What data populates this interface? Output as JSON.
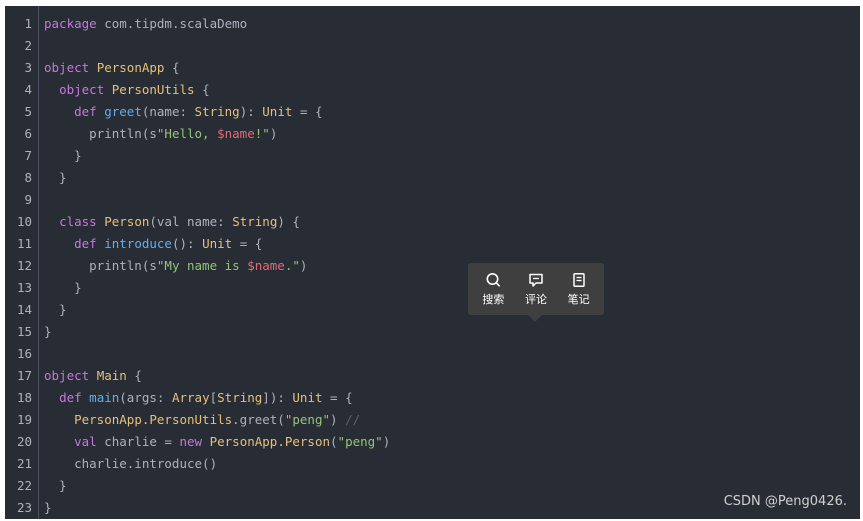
{
  "code_lines": [
    [
      {
        "t": "package",
        "c": "kw"
      },
      {
        "t": " com.tipdm.scalaDemo",
        "c": ""
      }
    ],
    [],
    [
      {
        "t": "object",
        "c": "kw"
      },
      {
        "t": " ",
        "c": ""
      },
      {
        "t": "PersonApp",
        "c": "cls"
      },
      {
        "t": " {",
        "c": ""
      }
    ],
    [
      {
        "t": "  ",
        "c": ""
      },
      {
        "t": "object",
        "c": "kw"
      },
      {
        "t": " ",
        "c": ""
      },
      {
        "t": "PersonUtils",
        "c": "cls"
      },
      {
        "t": " {",
        "c": ""
      }
    ],
    [
      {
        "t": "    ",
        "c": ""
      },
      {
        "t": "def",
        "c": "kw"
      },
      {
        "t": " ",
        "c": ""
      },
      {
        "t": "greet",
        "c": "fn"
      },
      {
        "t": "(name: ",
        "c": ""
      },
      {
        "t": "String",
        "c": "typ"
      },
      {
        "t": "): ",
        "c": ""
      },
      {
        "t": "Unit",
        "c": "typ"
      },
      {
        "t": " = {",
        "c": ""
      }
    ],
    [
      {
        "t": "      println(s",
        "c": ""
      },
      {
        "t": "\"Hello, ",
        "c": "str"
      },
      {
        "t": "$name",
        "c": "var"
      },
      {
        "t": "!\"",
        "c": "str"
      },
      {
        "t": ")",
        "c": ""
      }
    ],
    [
      {
        "t": "    }",
        "c": ""
      }
    ],
    [
      {
        "t": "  }",
        "c": ""
      }
    ],
    [],
    [
      {
        "t": "  ",
        "c": ""
      },
      {
        "t": "class",
        "c": "kw"
      },
      {
        "t": " ",
        "c": ""
      },
      {
        "t": "Person",
        "c": "cls"
      },
      {
        "t": "(val name: ",
        "c": ""
      },
      {
        "t": "String",
        "c": "typ"
      },
      {
        "t": ") {",
        "c": ""
      }
    ],
    [
      {
        "t": "    ",
        "c": ""
      },
      {
        "t": "def",
        "c": "kw"
      },
      {
        "t": " ",
        "c": ""
      },
      {
        "t": "introduce",
        "c": "fn"
      },
      {
        "t": "(): ",
        "c": ""
      },
      {
        "t": "Unit",
        "c": "typ"
      },
      {
        "t": " = {",
        "c": ""
      }
    ],
    [
      {
        "t": "      println(s",
        "c": ""
      },
      {
        "t": "\"My name is ",
        "c": "str"
      },
      {
        "t": "$name",
        "c": "var"
      },
      {
        "t": ".\"",
        "c": "str"
      },
      {
        "t": ")",
        "c": ""
      }
    ],
    [
      {
        "t": "    }",
        "c": ""
      }
    ],
    [
      {
        "t": "  }",
        "c": ""
      }
    ],
    [
      {
        "t": "}",
        "c": ""
      }
    ],
    [],
    [
      {
        "t": "object",
        "c": "kw"
      },
      {
        "t": " ",
        "c": ""
      },
      {
        "t": "Main",
        "c": "cls"
      },
      {
        "t": " {",
        "c": ""
      }
    ],
    [
      {
        "t": "  ",
        "c": ""
      },
      {
        "t": "def",
        "c": "kw"
      },
      {
        "t": " ",
        "c": ""
      },
      {
        "t": "main",
        "c": "fn"
      },
      {
        "t": "(args: ",
        "c": ""
      },
      {
        "t": "Array",
        "c": "typ"
      },
      {
        "t": "[",
        "c": ""
      },
      {
        "t": "String",
        "c": "typ"
      },
      {
        "t": "]): ",
        "c": ""
      },
      {
        "t": "Unit",
        "c": "typ"
      },
      {
        "t": " = {",
        "c": ""
      }
    ],
    [
      {
        "t": "    ",
        "c": ""
      },
      {
        "t": "PersonApp.PersonUtils",
        "c": "typ"
      },
      {
        "t": ".greet(",
        "c": ""
      },
      {
        "t": "\"peng\"",
        "c": "str"
      },
      {
        "t": ") ",
        "c": ""
      },
      {
        "t": "//",
        "c": "com"
      }
    ],
    [
      {
        "t": "    ",
        "c": ""
      },
      {
        "t": "val",
        "c": "kw"
      },
      {
        "t": " charlie = ",
        "c": ""
      },
      {
        "t": "new",
        "c": "kw"
      },
      {
        "t": " ",
        "c": ""
      },
      {
        "t": "PersonApp.Person",
        "c": "typ"
      },
      {
        "t": "(",
        "c": ""
      },
      {
        "t": "\"peng\"",
        "c": "str"
      },
      {
        "t": ")",
        "c": ""
      }
    ],
    [
      {
        "t": "    charlie.introduce()",
        "c": ""
      }
    ],
    [
      {
        "t": "  }",
        "c": ""
      }
    ],
    [
      {
        "t": "}",
        "c": ""
      }
    ]
  ],
  "tooltip": {
    "search_label": "搜索",
    "comment_label": "评论",
    "note_label": "笔记"
  },
  "watermark": "CSDN @Peng0426."
}
